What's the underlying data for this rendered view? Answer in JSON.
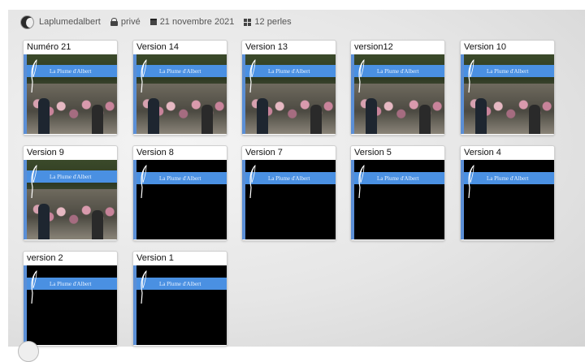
{
  "header": {
    "username": "Laplumedalbert",
    "privacy": "privé",
    "date": "21 novembre 2021",
    "count": "12 perles"
  },
  "cards": [
    {
      "title": "Numéro 21",
      "thumb": "photo",
      "banner": "La Plume d'Albert"
    },
    {
      "title": "Version 14",
      "thumb": "photo",
      "banner": "La Plume d'Albert"
    },
    {
      "title": "Version 13",
      "thumb": "photo",
      "banner": "La Plume d'Albert"
    },
    {
      "title": "version12",
      "thumb": "photo",
      "banner": "La Plume d'Albert"
    },
    {
      "title": "Version 10",
      "thumb": "photo",
      "banner": "La Plume d'Albert"
    },
    {
      "title": "Version 9",
      "thumb": "photo",
      "banner": "La Plume d'Albert"
    },
    {
      "title": "Version 8",
      "thumb": "dark",
      "banner": "La Plume d'Albert"
    },
    {
      "title": "Version 7",
      "thumb": "dark",
      "banner": "La Plume d'Albert"
    },
    {
      "title": "Version 5",
      "thumb": "dark",
      "banner": "La Plume d'Albert"
    },
    {
      "title": "Version 4",
      "thumb": "dark",
      "banner": "La Plume d'Albert"
    },
    {
      "title": "version 2",
      "thumb": "dark",
      "banner": "La Plume d'Albert"
    },
    {
      "title": "Version 1",
      "thumb": "dark",
      "banner": "La Plume d'Albert"
    }
  ],
  "colors": {
    "banner": "#4a90e2",
    "accent_bar": "#5b8fd6"
  },
  "icons": {
    "privacy": "lock-icon",
    "date": "calendar-icon",
    "count": "grid-icon"
  }
}
